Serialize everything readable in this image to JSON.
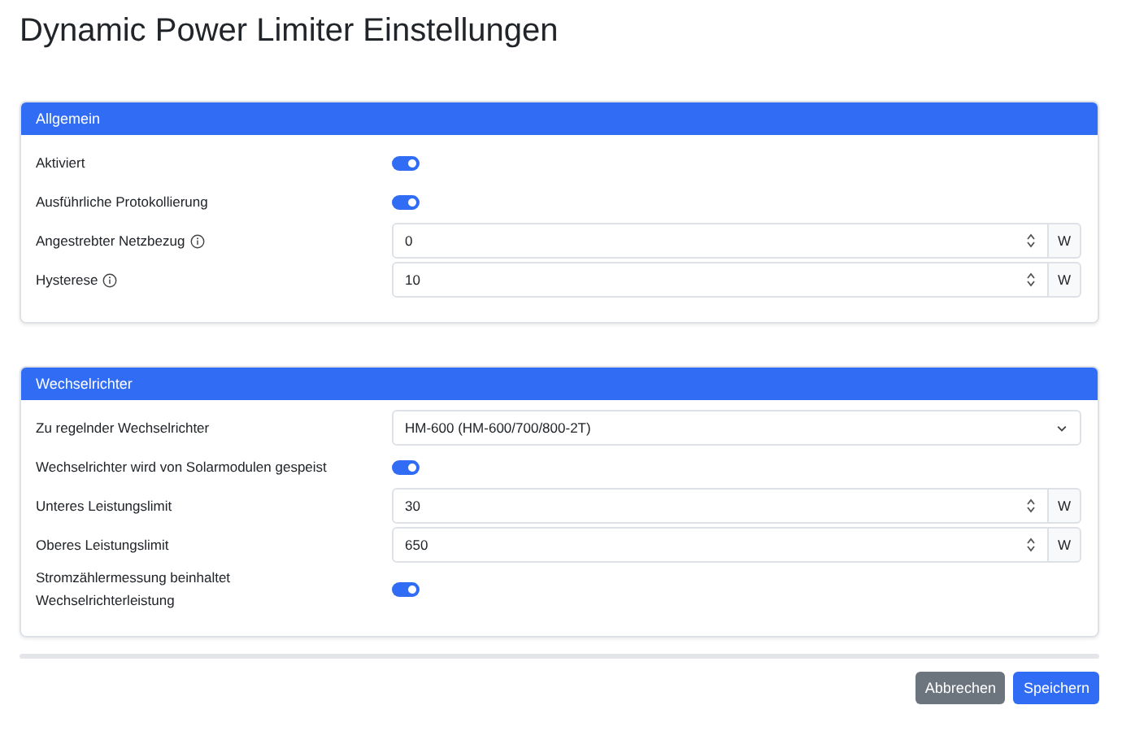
{
  "title": "Dynamic Power Limiter Einstellungen",
  "sections": [
    {
      "header": "Allgemein",
      "rows": [
        {
          "kind": "toggle",
          "label": "Aktiviert",
          "on": true
        },
        {
          "kind": "toggle",
          "label": "Ausführliche Protokollierung",
          "on": true
        },
        {
          "kind": "number",
          "label": "Angestrebter Netzbezug",
          "info": true,
          "value": "0",
          "unit": "W"
        },
        {
          "kind": "number",
          "label": "Hysterese",
          "info": true,
          "value": "10",
          "unit": "W"
        }
      ]
    },
    {
      "header": "Wechselrichter",
      "rows": [
        {
          "kind": "select",
          "label": "Zu regelnder Wechselrichter",
          "value": "HM-600 (HM-600/700/800-2T)"
        },
        {
          "kind": "toggle",
          "label": "Wechselrichter wird von Solarmodulen gespeist",
          "on": true
        },
        {
          "kind": "number",
          "label": "Unteres Leistungslimit",
          "value": "30",
          "unit": "W"
        },
        {
          "kind": "number",
          "label": "Oberes Leistungslimit",
          "value": "650",
          "unit": "W"
        },
        {
          "kind": "toggle",
          "label": "Stromzählermessung beinhaltet Wechselrichterleistung",
          "on": true
        }
      ]
    }
  ],
  "buttons": [
    {
      "label": "Abbrechen",
      "kind": "secondary"
    },
    {
      "label": "Speichern",
      "kind": "primary"
    }
  ]
}
